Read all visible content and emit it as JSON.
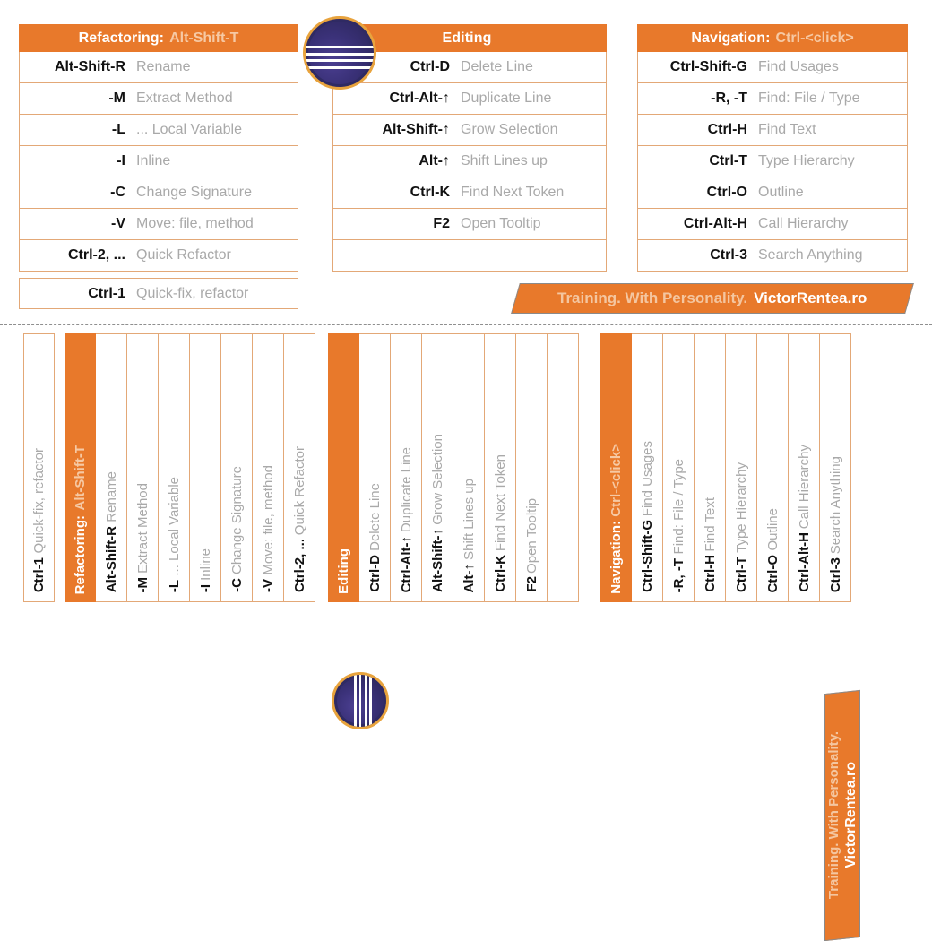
{
  "meta": {
    "colors": {
      "orange": "#e8792b",
      "border_light_orange": "#e3a877",
      "description_gray": "#a9a9a9",
      "key_black": "#111111",
      "header_subtext": "#f6c9a4",
      "logo_purple": "#2f2a63",
      "logo_ring_gold": "#e8a33d"
    }
  },
  "banner": {
    "text_light": "Training. With Personality.",
    "text_bold": "VictorRentea.ro"
  },
  "logo": {
    "name": "eclipse-logo"
  },
  "sections": [
    {
      "id": "refactoring",
      "title": "Refactoring:",
      "subtitle": "Alt-Shift-T",
      "rows": [
        {
          "key": "Alt-Shift-R",
          "desc": "Rename"
        },
        {
          "key": "-M",
          "desc": "Extract Method"
        },
        {
          "key": "-L",
          "desc": "... Local Variable"
        },
        {
          "key": "-I",
          "desc": "Inline"
        },
        {
          "key": "-C",
          "desc": "Change Signature"
        },
        {
          "key": "-V",
          "desc": "Move: file, method"
        },
        {
          "key": "Ctrl-2, ...",
          "desc": "Quick Refactor"
        }
      ]
    },
    {
      "id": "editing",
      "title": "Editing",
      "subtitle": "",
      "rows": [
        {
          "key": "Ctrl-D",
          "desc": "Delete Line"
        },
        {
          "key": "Ctrl-Alt-↑",
          "desc": "Duplicate Line"
        },
        {
          "key": "Alt-Shift-↑",
          "desc": "Grow Selection"
        },
        {
          "key": "Alt-↑",
          "desc": "Shift Lines up"
        },
        {
          "key": "Ctrl-K",
          "desc": "Find Next Token"
        },
        {
          "key": "F2",
          "desc": "Open Tooltip"
        },
        {
          "key": "",
          "desc": ""
        }
      ]
    },
    {
      "id": "navigation",
      "title": "Navigation:",
      "subtitle": "Ctrl-<click>",
      "rows": [
        {
          "key": "Ctrl-Shift-G",
          "desc": "Find Usages"
        },
        {
          "key": "-R, -T",
          "desc": "Find: File / Type"
        },
        {
          "key": "Ctrl-H",
          "desc": "Find Text"
        },
        {
          "key": "Ctrl-T",
          "desc": "Type Hierarchy"
        },
        {
          "key": "Ctrl-O",
          "desc": "Outline"
        },
        {
          "key": "Ctrl-Alt-H",
          "desc": "Call Hierarchy"
        },
        {
          "key": "Ctrl-3",
          "desc": "Search Anything"
        }
      ]
    }
  ],
  "standalone": {
    "key": "Ctrl-1",
    "desc": "Quick-fix, refactor"
  }
}
